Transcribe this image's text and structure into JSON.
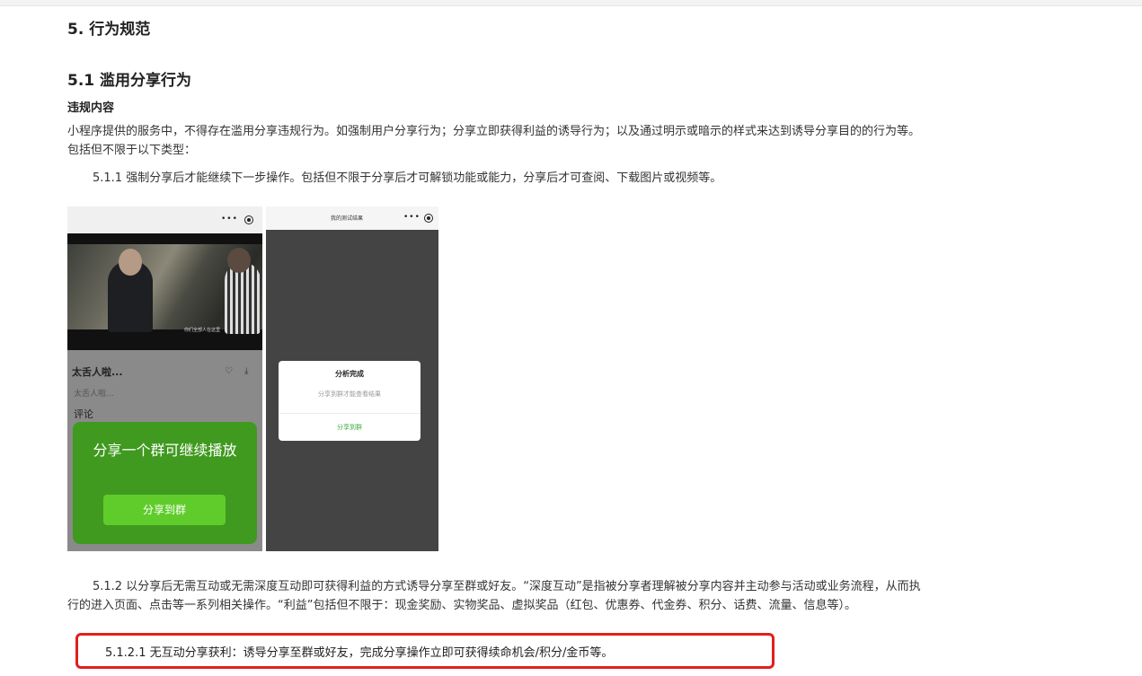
{
  "heading_5": "5. 行为规范",
  "heading_5_1": "5.1 滥用分享行为",
  "violation_label": "违规内容",
  "para_intro": "小程序提供的服务中，不得存在滥用分享违规行为。如强制用户分享行为；分享立即获得利益的诱导行为；以及通过明示或暗示的样式来达到诱导分享目的的行为等。包括但不限于以下类型：",
  "para_5_1_1": "5.1.1 强制分享后才能继续下一步操作。包括但不限于分享后才可解锁功能或能力，分享后才可查阅、下载图片或视频等。",
  "phone1": {
    "dots": "•••",
    "subtitle": "你们全部人在这里",
    "name": "太舌人啦...",
    "handle": "太舌人啦...",
    "comment": "评论",
    "like_icon": "heart-icon",
    "download_icon": "download-icon",
    "overlay_text": "分享一个群可继续播放",
    "share_button": "分享到群"
  },
  "phone2": {
    "title": "我的测试结果",
    "dots": "•••",
    "dialog_title": "分析完成",
    "dialog_message": "分享到群才能查看结果",
    "dialog_button": "分享到群"
  },
  "para_5_1_2": "5.1.2 以分享后无需互动或无需深度互动即可获得利益的方式诱导分享至群或好友。“深度互动”是指被分享者理解被分享内容并主动参与活动或业务流程，从而执行的进入页面、点击等一系列相关操作。“利益”包括但不限于：现金奖励、实物奖品、虚拟奖品（红包、优惠券、代金券、积分、话费、流量、信息等）。",
  "para_5_1_2_1": "5.1.2.1 无互动分享获利：诱导分享至群或好友，完成分享操作立即可获得续命机会/积分/金币等。",
  "colors": {
    "highlight": "#e0201c",
    "share_green": "#3f9a1f"
  }
}
